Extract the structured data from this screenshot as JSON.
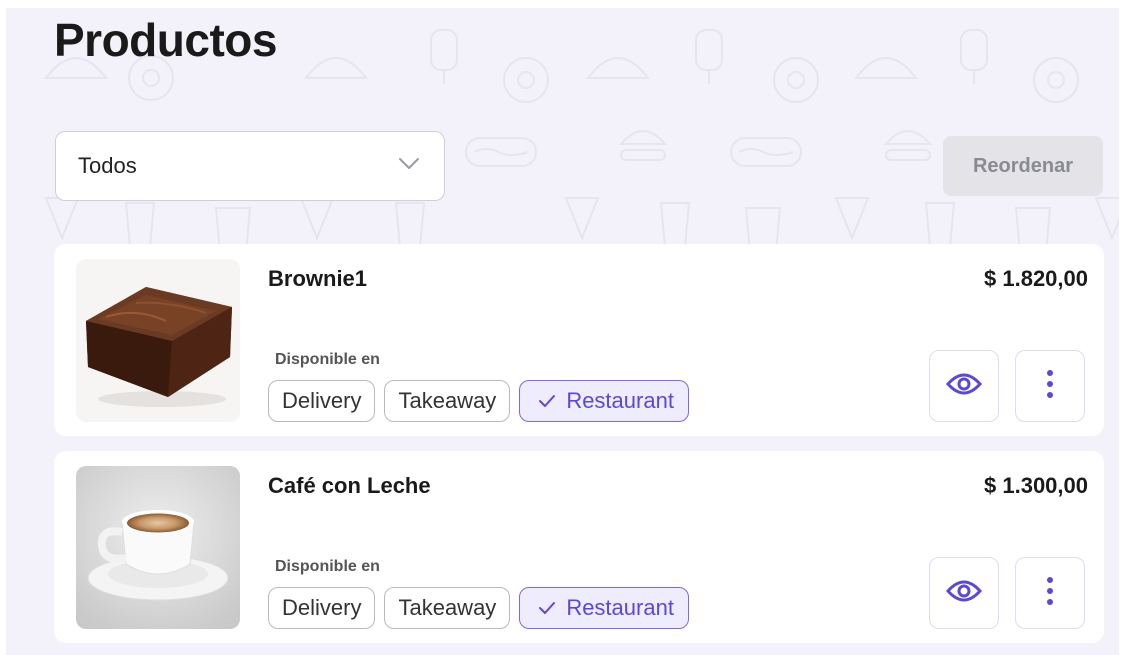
{
  "page": {
    "title": "Productos"
  },
  "filter": {
    "selected": "Todos"
  },
  "toolbar": {
    "reorder_label": "Reordenar"
  },
  "available_label": "Disponible en",
  "colors": {
    "accent": "#5b49d6",
    "accent_bg": "#eeecfd",
    "background": "#f3f2fa"
  },
  "products": [
    {
      "name": "Brownie1",
      "price": "$ 1.820,00",
      "image": "brownie",
      "channels": [
        {
          "label": "Delivery",
          "active": false
        },
        {
          "label": "Takeaway",
          "active": false
        },
        {
          "label": "Restaurant",
          "active": true
        }
      ]
    },
    {
      "name": "Café con Leche",
      "price": "$ 1.300,00",
      "image": "coffee-cup",
      "channels": [
        {
          "label": "Delivery",
          "active": false
        },
        {
          "label": "Takeaway",
          "active": false
        },
        {
          "label": "Restaurant",
          "active": true
        }
      ]
    }
  ]
}
